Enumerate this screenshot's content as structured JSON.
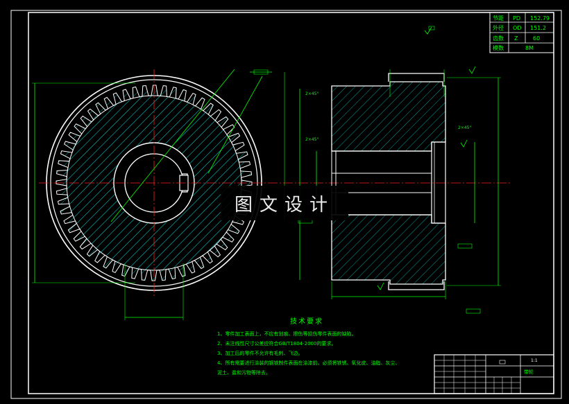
{
  "param_table": {
    "rows": [
      {
        "label": "节距",
        "symbol": "PD",
        "value": "152.79"
      },
      {
        "label": "外径",
        "symbol": "OD",
        "value": "151.2"
      },
      {
        "label": "齿数",
        "symbol": "Z",
        "value": "60"
      },
      {
        "label": "模数",
        "symbol": "",
        "value": "8M"
      }
    ]
  },
  "tech_requirements": {
    "title": "技术要求",
    "items": [
      "1、零件加工表面上，不应有划痕、擦伤等损伤零件表面的缺陷。",
      "2、未注线性尺寸公差应符合GB/T1804-2000的要求。",
      "3、加工后的零件不允许有毛刺、飞边。",
      "4、所有需要进行涂装的钢铁制件表面在涂漆前，必须将铁锈、氧化皮、油脂、灰尘、",
      "泥土、盐和污物等除去。"
    ]
  },
  "title_block": {
    "part_name": "带轮",
    "scale": "1:1"
  },
  "dimensions": {
    "chamfer_1": "2×45°",
    "chamfer_2": "2×45°",
    "chamfer_3": "2×45°",
    "surface_mark": "Ra"
  },
  "watermark": "图文设计",
  "colors": {
    "background": "#000000",
    "outline": "#ffffff",
    "dimension": "#00ff00",
    "hatch": "#00c8c8",
    "centerline": "#ff2020"
  }
}
